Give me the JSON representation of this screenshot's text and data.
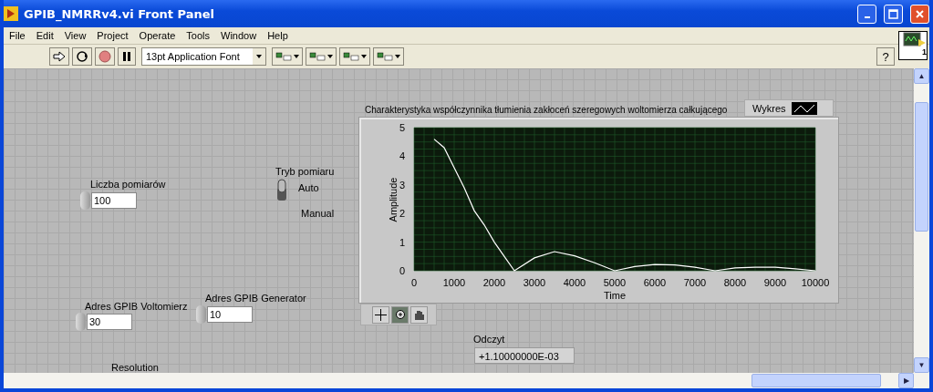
{
  "window": {
    "title": "GPIB_NMRRv4.vi Front Panel"
  },
  "menu": [
    "File",
    "Edit",
    "View",
    "Project",
    "Operate",
    "Tools",
    "Window",
    "Help"
  ],
  "toolbar": {
    "font": "13pt Application Font",
    "help": "?",
    "connector_number": "1"
  },
  "numerics": [
    {
      "label": "Liczba pomiarów",
      "value": "100"
    },
    {
      "label": "Adres GPIB Voltomierz",
      "value": "30"
    },
    {
      "label": "Adres GPIB Generator",
      "value": "10"
    }
  ],
  "toggle": {
    "label": "Tryb pomiaru",
    "on": true,
    "on_label": "Auto",
    "off_label": "Manual"
  },
  "graph": {
    "title": "Charakterystyka współczynnika tłumienia zakłoceń szeregowych woltomierza całkującego",
    "chart_data": {
      "type": "line",
      "grid": true,
      "xlabel": "Time",
      "ylabel": "Amplitude",
      "x": [
        500,
        750,
        1000,
        1250,
        1500,
        1750,
        2000,
        2250,
        2500,
        3000,
        3500,
        4000,
        4500,
        5000,
        5500,
        6000,
        6500,
        7000,
        7500,
        8000,
        8500,
        9000,
        9500,
        10000
      ],
      "series": [
        {
          "name": "Wykres",
          "color": "#ffffff",
          "values": [
            4.6,
            4.3,
            3.6,
            2.9,
            2.1,
            1.6,
            1.0,
            0.5,
            0,
            0.45,
            0.67,
            0.52,
            0.28,
            0,
            0.15,
            0.22,
            0.2,
            0.12,
            0,
            0.1,
            0.12,
            0.12,
            0.07,
            0
          ]
        }
      ],
      "xlim": [
        0,
        10000
      ],
      "ylim": [
        0,
        5
      ],
      "xticks": [
        0,
        1000,
        2000,
        3000,
        4000,
        5000,
        6000,
        7000,
        8000,
        9000,
        10000
      ],
      "yticks": [
        0,
        1,
        2,
        3,
        4,
        5
      ]
    }
  },
  "indicator": {
    "label": "Odczyt",
    "value": "+1.10000000E-03"
  },
  "partial_label": "Resolution",
  "scrollbars": {
    "up": "▲",
    "down": "▼",
    "right": "▶"
  }
}
